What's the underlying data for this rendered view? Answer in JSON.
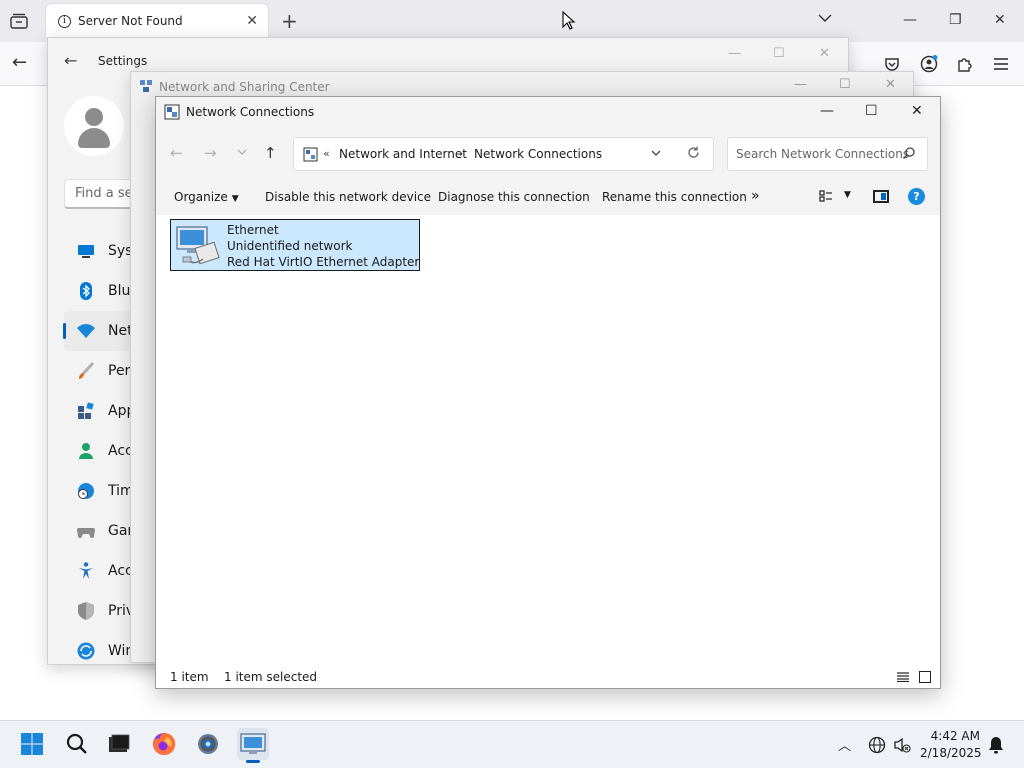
{
  "browser": {
    "tab_title": "Server Not Found",
    "tab_icon": "info-icon",
    "new_tab": "+"
  },
  "settings": {
    "title": "Settings",
    "search_placeholder": "Find a se",
    "nav_items": [
      {
        "label": "Syst",
        "icon": "system-icon",
        "color": "#0078d4"
      },
      {
        "label": "Blue",
        "icon": "bluetooth-icon",
        "color": "#0078d4"
      },
      {
        "label": "Net",
        "icon": "wifi-icon",
        "color": "#1a86d9",
        "selected": true
      },
      {
        "label": "Pers",
        "icon": "brush-icon",
        "color": "#e06a1a"
      },
      {
        "label": "App",
        "icon": "apps-icon",
        "color": "#3a5a8c"
      },
      {
        "label": "Acc",
        "icon": "accounts-icon",
        "color": "#1aa36a"
      },
      {
        "label": "Tim",
        "icon": "time-language-icon",
        "color": "#1a86d9"
      },
      {
        "label": "Gar",
        "icon": "gaming-icon",
        "color": "#6b6b6b"
      },
      {
        "label": "Acc",
        "icon": "accessibility-icon",
        "color": "#1a6fc1"
      },
      {
        "label": "Priv",
        "icon": "privacy-shield-icon",
        "color": "#8a8a8a"
      },
      {
        "label": "Win",
        "icon": "windows-update-icon",
        "color": "#1a86d9"
      }
    ]
  },
  "nsc": {
    "title": "Network and Sharing Center"
  },
  "netconn": {
    "title": "Network Connections",
    "breadcrumb_prefix": "«",
    "breadcrumb": [
      "Network and Internet",
      "Network Connections"
    ],
    "search_placeholder": "Search Network Connections",
    "commands": {
      "organize": "Organize",
      "disable": "Disable this network device",
      "diagnose": "Diagnose this connection",
      "rename": "Rename this connection",
      "more": "»"
    },
    "connection": {
      "name": "Ethernet",
      "status": "Unidentified network",
      "device": "Red Hat VirtIO Ethernet Adapter"
    },
    "status": {
      "count": "1 item",
      "selected": "1 item selected"
    }
  },
  "taskbar": {
    "time": "4:42 AM",
    "date": "2/18/2025",
    "apps": [
      "start-icon",
      "search-icon",
      "terminal-icon",
      "firefox-icon",
      "settings-gear-icon",
      "network-connections-icon"
    ]
  },
  "colors": {
    "accent": "#005fb8",
    "selection": "#cce8ff",
    "help_blue": "#1a8cde"
  }
}
